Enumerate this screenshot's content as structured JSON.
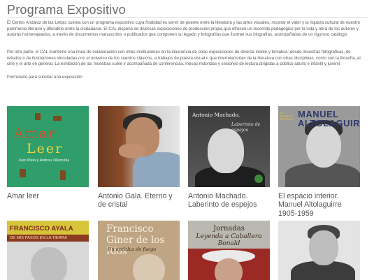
{
  "page": {
    "title": "Programa Expositivo",
    "intro_1": "El Centro Andaluz de las Letras cuenta con un programa expositivo cuya finalidad es servir de puente entre la literatura y las artes visuales, mostrar el valor y la riqueza cultural de nuestro patrimonio literario y difundirlo entre la ciudadanía. El CAL dispone de diversas exposiciones de producción propia que ofrecen un recorrido pedagógico por la vida y obra de los autores y autoras homenajeados, a través de documentos manuscritos o publicados que componen su legado y fotografías que ilustran sus biografías, acompañadas de un riguroso catálogo.",
    "intro_2": "Por otra parte, el CAL mantiene una línea de colaboración con otras instituciones en la itinerancia de otras exposiciones de diversa índole y temática: desde muestras fotográficas, de retratos o de ilustraciones vinculadas con el universo de los cuentos clásicos, a trabajos de poesía visual o que interrelacionan de la literatura con otras disciplinas, como son la filosofía, el cine y el arte en general. La exhibición de las muestras suele ir acompañada de conferencias, mesas redondas y sesiones de lectura dirigidas a público adulto e infantil y juvenil.",
    "form_link": "Formulario para solicitar una exposición"
  },
  "exhibitions": [
    {
      "title": "Amar leer",
      "cover": {
        "line1": "Amar",
        "line2": "Leer",
        "authors": "Juan Mata y Andrea Villarrubia"
      }
    },
    {
      "title": "Antonio Gala. Eterno y de cristal"
    },
    {
      "title": "Antonio Machado. Laberinto de espejos",
      "cover": {
        "name": "Antonio Machado.",
        "subtitle": "Laberinto de espejos"
      }
    },
    {
      "title": "El espacio interior. Manuel Altolaguirre 1905-1959",
      "cover": {
        "kicker": "EL ESPACIO INTERIOR",
        "name": "MANUEL ALTOLAGUIRRE"
      }
    },
    {
      "title": "",
      "cover": {
        "name": "FRANCISCO AYALA",
        "subtitle": "DE MIS PASOS EN LA TIERRA"
      }
    },
    {
      "title": "",
      "cover": {
        "line1": "Francisco",
        "line2": "Giner de los Ríos",
        "subtitle": "Un andaluz de fuego"
      }
    },
    {
      "title": "",
      "cover": {
        "line1": "Jornadas",
        "line2": "Leyenda a Caballero Bonald"
      }
    },
    {
      "title": ""
    }
  ],
  "colors": {
    "title": "#6b6b6b",
    "body_text": "#5a5a5a"
  }
}
